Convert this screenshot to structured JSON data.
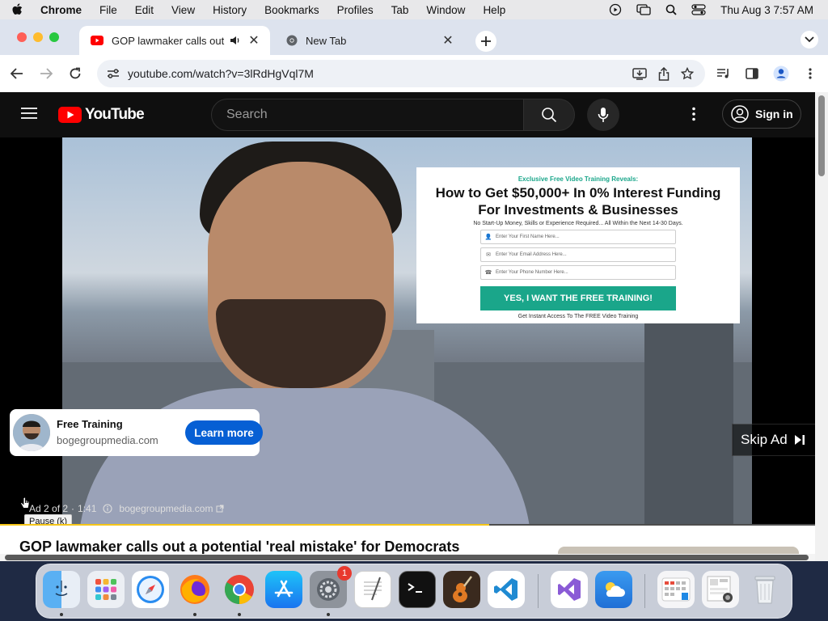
{
  "menubar": {
    "app": "Chrome",
    "items": [
      "File",
      "Edit",
      "View",
      "History",
      "Bookmarks",
      "Profiles",
      "Tab",
      "Window",
      "Help"
    ],
    "clock": "Thu Aug 3  7:57 AM"
  },
  "tabs": [
    {
      "title": "GOP lawmaker calls out a",
      "active": true,
      "audio": true
    },
    {
      "title": "New Tab",
      "active": false
    }
  ],
  "address": {
    "url": "youtube.com/watch?v=3lRdHgVql7M"
  },
  "youtube": {
    "logo_text": "YouTube",
    "search_placeholder": "Search",
    "sign_in": "Sign in",
    "ad": {
      "kicker": "Exclusive Free Video Training Reveals:",
      "headline_1": "How to Get $50,000+ In 0% Interest Funding",
      "headline_2": "For Investments & Businesses",
      "sub": "No Start-Up Money, Skills or Experience Required... All Within the Next 14-30 Days.",
      "field_name": "Enter Your First Name Here...",
      "field_email": "Enter Your Email Address Here...",
      "field_phone": "Enter Your Phone Number Here...",
      "cta": "YES, I WANT THE FREE TRAINING!",
      "note": "Get Instant Access To The FREE Video Training"
    },
    "promo": {
      "title": "Free Training",
      "domain": "bogegroupmedia.com",
      "button": "Learn more"
    },
    "skip": "Skip Ad",
    "ad_info": {
      "count": "Ad 2 of 2",
      "time": "1:41",
      "domain": "bogegroupmedia.com"
    },
    "tooltip": "Pause (k)",
    "progress": 0.6,
    "video_title": "GOP lawmaker calls out a potential 'real mistake' for Democrats"
  },
  "dock": {
    "apps": [
      "Finder",
      "Launchpad",
      "Safari",
      "Firefox",
      "Chrome",
      "App Store",
      "System Settings",
      "TextEdit",
      "Terminal",
      "GarageBand",
      "VS Code",
      "Visual Studio",
      "Weather",
      "Calendar Widget",
      "Downloads",
      "Trash"
    ],
    "badge": "1"
  },
  "colors": {
    "youtube_red": "#ff0000",
    "learn_more_blue": "#065fd4",
    "ad_green": "#1aa68a",
    "progress_yellow": "#f5c518"
  }
}
